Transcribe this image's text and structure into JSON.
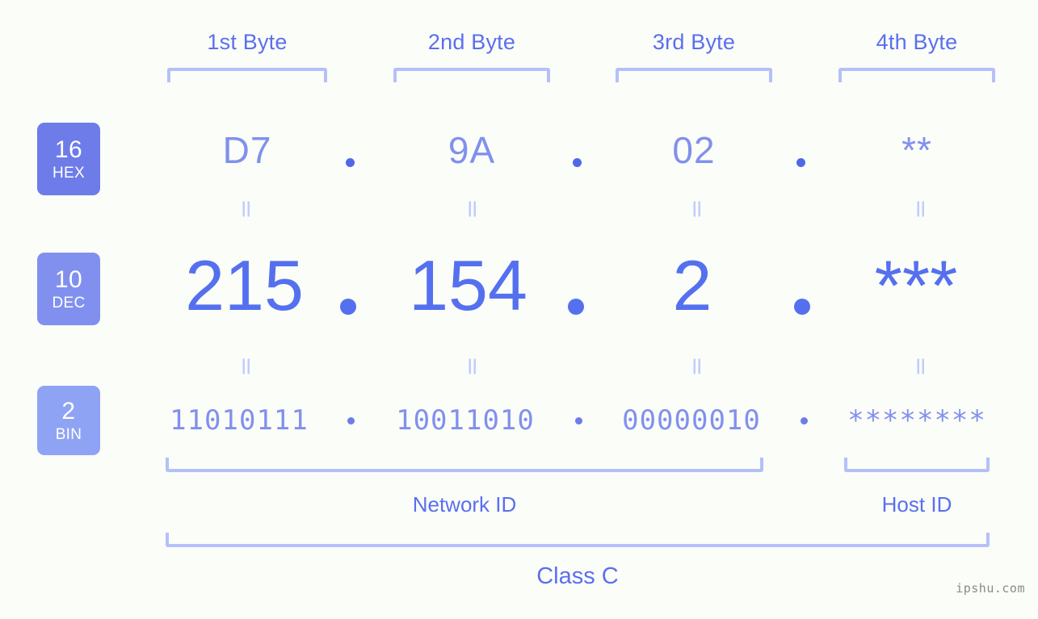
{
  "meta": {
    "watermark": "ipshu.com",
    "background_color": "#fbfdf8",
    "accent_color": "#5a6ff0",
    "bracket_color": "#b5c0fa"
  },
  "columns": [
    {
      "label": "1st Byte"
    },
    {
      "label": "2nd Byte"
    },
    {
      "label": "3rd Byte"
    },
    {
      "label": "4th Byte"
    }
  ],
  "rows": [
    {
      "badge_number": "16",
      "badge_word": "HEX",
      "badge_color": "#6d7ce8",
      "values": [
        "D7",
        "9A",
        "02",
        "**"
      ]
    },
    {
      "badge_number": "10",
      "badge_word": "DEC",
      "badge_color": "#8190ee",
      "values": [
        "215",
        "154",
        "2",
        "***"
      ]
    },
    {
      "badge_number": "2",
      "badge_word": "BIN",
      "badge_color": "#8fa3f5",
      "values": [
        "11010111",
        "10011010",
        "00000010",
        "********"
      ]
    }
  ],
  "separators": {
    "dot": ".",
    "equals": "="
  },
  "regions": {
    "network_id": "Network ID",
    "host_id": "Host ID",
    "class": "Class C"
  }
}
